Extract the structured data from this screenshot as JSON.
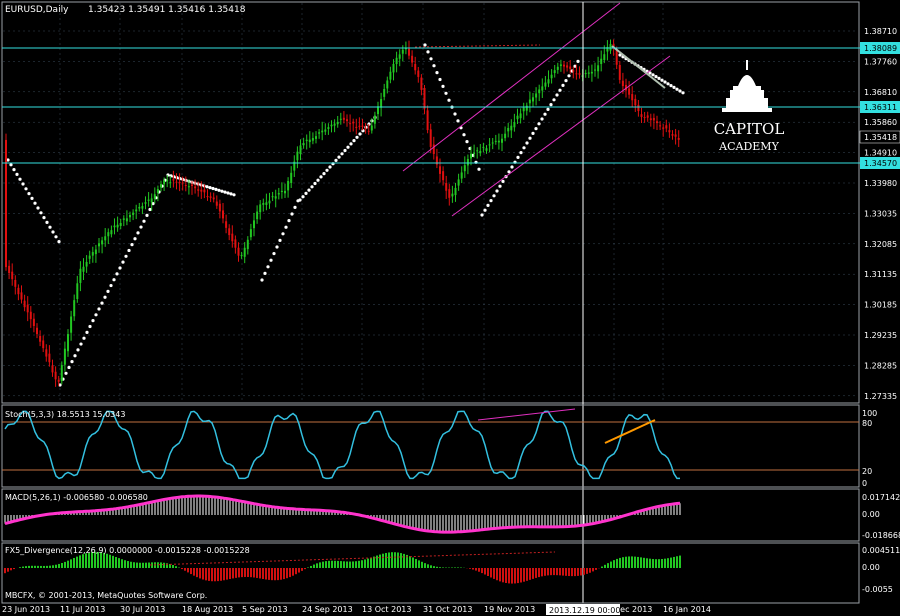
{
  "window": {
    "title": "EURUSD,Daily",
    "ohlc": "1.35423 1.35491 1.35416 1.35418"
  },
  "price_axis": {
    "ticks": [
      "1.38710",
      "1.37760",
      "1.36810",
      "1.35860",
      "1.34910",
      "1.33980",
      "1.33035",
      "1.32085",
      "1.31135",
      "1.30185",
      "1.29235",
      "1.28285",
      "1.27335"
    ],
    "current_price": "1.35418"
  },
  "hlines": [
    {
      "label": "1.38089",
      "color": "#33e0e0"
    },
    {
      "label": "1.36311",
      "color": "#33e0e0"
    },
    {
      "label": "1.34570",
      "color": "#33e0e0"
    }
  ],
  "logo": {
    "line1": "CAPITOL",
    "line2": "ACADEMY"
  },
  "indicators": {
    "stoch": {
      "label": "Stoch(5,3,3) 18.5513 15.0343",
      "levels": [
        "100",
        "80",
        "20",
        "0"
      ]
    },
    "macd": {
      "label": "MACD(5,26,1) -0.006580 -0.006580",
      "levels": [
        "0.017142",
        "0.00",
        "-0.018668"
      ]
    },
    "fx5": {
      "label": "FX5_Divergence(12,26,9) 0.0000000 -0.0015228 -0.0015228",
      "levels": [
        "0.004511",
        "0.00",
        "-0.0055"
      ]
    }
  },
  "footer": {
    "copyright": "MBCFX, © 2001-2013, MetaQuotes Software Corp."
  },
  "date_axis": {
    "labels": [
      "23 Jun 2013",
      "11 Jul 2013",
      "30 Jul 2013",
      "18 Aug 2013",
      "5 Sep 2013",
      "24 Sep 2013",
      "13 Oct 2013",
      "31 Oct 2013",
      "19 Nov 2013",
      "Dec 2013",
      "16 Jan 2014"
    ],
    "crosshair_label": "2013.12.19 00:00"
  },
  "colors": {
    "bull": "#22c722",
    "bear": "#e01010",
    "level": "#33e0e0",
    "channel": "#e030c0",
    "stoch": "#33c0e0",
    "macd_signal": "#ff33cc",
    "sar": "#ffffff",
    "grid": "#3a4a5a"
  }
}
